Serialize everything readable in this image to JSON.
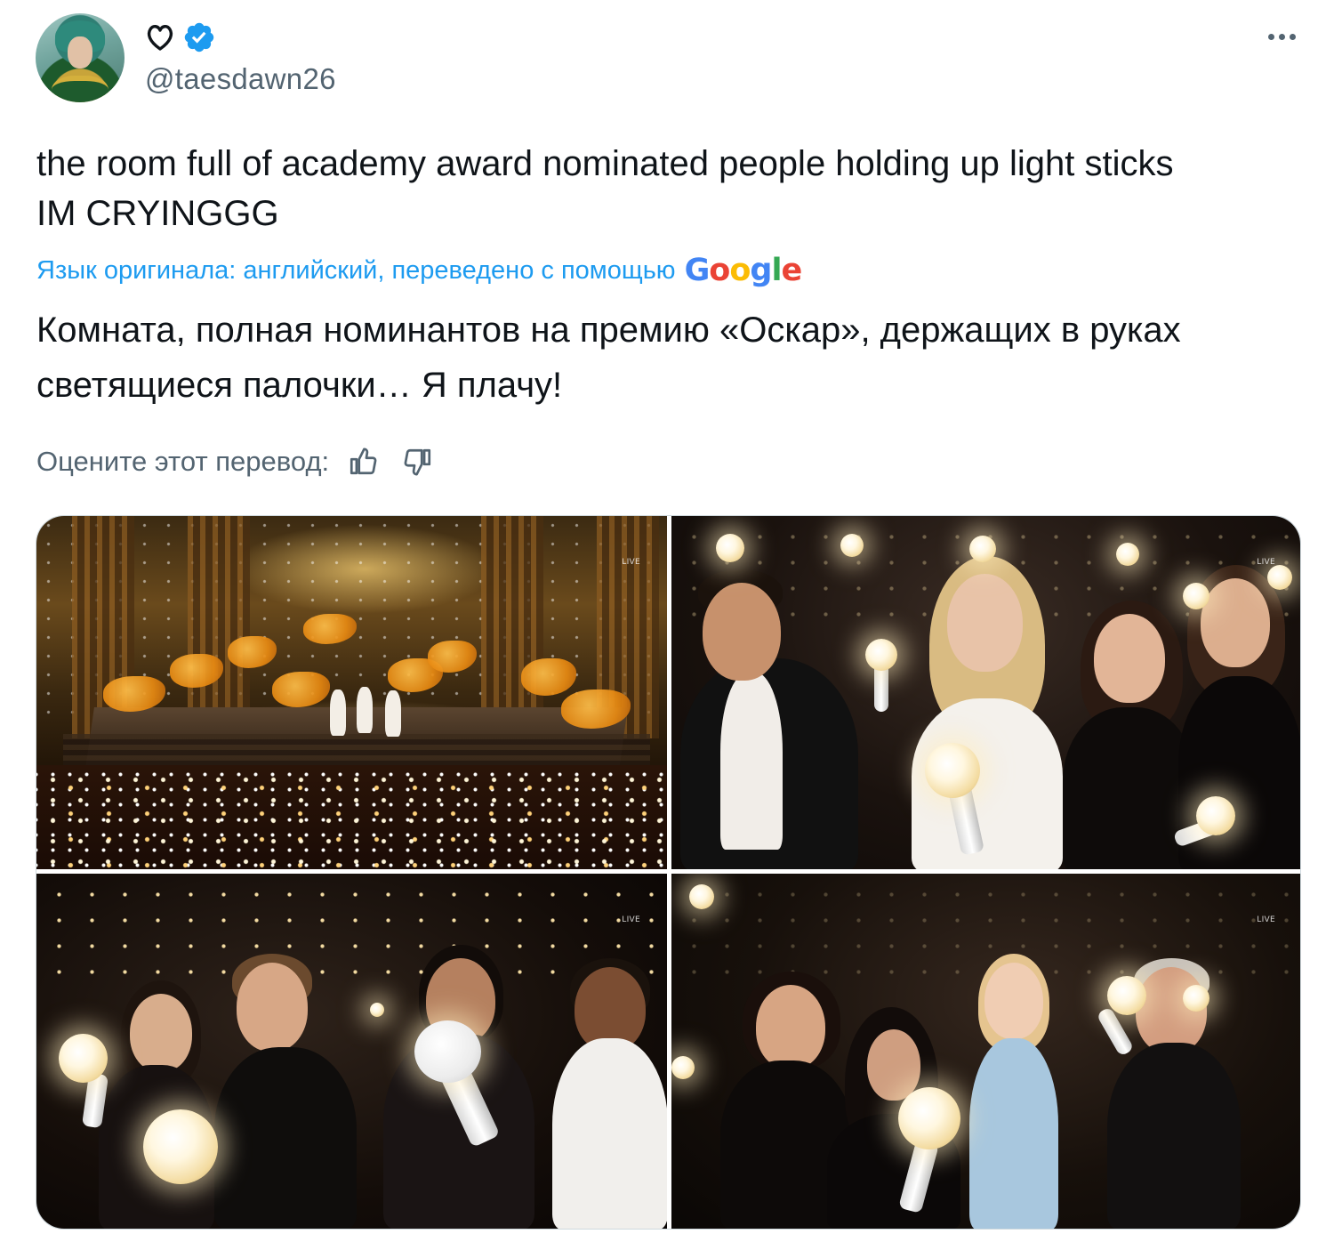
{
  "tweet": {
    "display_name_icons": [
      "heart-icon",
      "verified-badge-icon"
    ],
    "handle": "@taesdawn26",
    "text_lines": [
      "the room full of academy award nominated people holding up light sticks",
      "IM CRYINGGG"
    ],
    "translation_notice": "Язык оригинала: английский, переведено с помощью",
    "translation_provider": "Google",
    "translated_lines": [
      "Комната, полная номинантов на премию «Оскар», держащих в руках",
      "светящиеся палочки… Я плачу!"
    ],
    "rate_prompt": "Оцените этот перевод:",
    "media_badges": [
      "LIVE",
      "LIVE",
      "LIVE",
      "LIVE"
    ]
  },
  "colors": {
    "text": "#0f1419",
    "secondary": "#536471",
    "link": "#1d9bf0",
    "verified": "#1d9bf0",
    "border": "#cfd9de"
  },
  "icons": {
    "more": "more-horizontal-icon",
    "rate_up": "thumb-up-icon",
    "rate_down": "thumb-down-icon"
  }
}
